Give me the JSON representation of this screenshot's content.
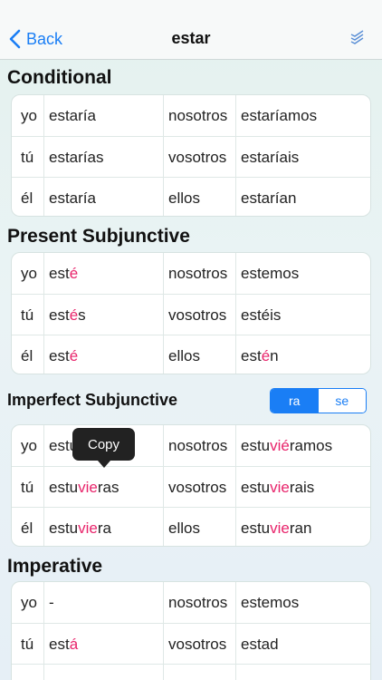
{
  "nav": {
    "back_label": "Back",
    "title": "estar"
  },
  "colors": {
    "accent": "#1a7ef5",
    "highlight": "#e8246b"
  },
  "sections": {
    "conditional": {
      "title": "Conditional",
      "rows": [
        {
          "p1": "yo",
          "f1": "estaría",
          "p2": "nosotros",
          "f2": "estaríamos"
        },
        {
          "p1": "tú",
          "f1": "estarías",
          "p2": "vosotros",
          "f2": "estaríais"
        },
        {
          "p1": "él",
          "f1": "estaría",
          "p2": "ellos",
          "f2": "estarían"
        }
      ]
    },
    "present_subjunctive": {
      "title": "Present Subjunctive",
      "rows": [
        {
          "p1": "yo",
          "f1a": "est",
          "f1b": "é",
          "f1c": "",
          "p2": "nosotros",
          "f2a": "estemos",
          "f2b": "",
          "f2c": ""
        },
        {
          "p1": "tú",
          "f1a": "est",
          "f1b": "é",
          "f1c": "s",
          "p2": "vosotros",
          "f2a": "estéis",
          "f2b": "",
          "f2c": ""
        },
        {
          "p1": "él",
          "f1a": "est",
          "f1b": "é",
          "f1c": "",
          "p2": "ellos",
          "f2a": "est",
          "f2b": "é",
          "f2c": "n"
        }
      ]
    },
    "imperfect_subjunctive": {
      "title": "Imperfect Subjunctive",
      "segment_ra": "ra",
      "segment_se": "se",
      "tooltip": "Copy",
      "rows": [
        {
          "p1": "yo",
          "f1a": "estu",
          "f1b": "",
          "f1c": "",
          "p2": "nosotros",
          "f2a": "estu",
          "f2b": "vié",
          "f2c": "ramos"
        },
        {
          "p1": "tú",
          "f1a": "estu",
          "f1b": "vie",
          "f1c": "ras",
          "p2": "vosotros",
          "f2a": "estu",
          "f2b": "vie",
          "f2c": "rais"
        },
        {
          "p1": "él",
          "f1a": "estu",
          "f1b": "vie",
          "f1c": "ra",
          "p2": "ellos",
          "f2a": "estu",
          "f2b": "vie",
          "f2c": "ran"
        }
      ]
    },
    "imperative": {
      "title": "Imperative",
      "rows": [
        {
          "p1": "yo",
          "f1a": "-",
          "f1b": "",
          "f1c": "",
          "p2": "nosotros",
          "f2a": "estemos",
          "f2b": "",
          "f2c": ""
        },
        {
          "p1": "tú",
          "f1a": "est",
          "f1b": "á",
          "f1c": "",
          "p2": "vosotros",
          "f2a": "estad",
          "f2b": "",
          "f2c": ""
        }
      ]
    }
  }
}
